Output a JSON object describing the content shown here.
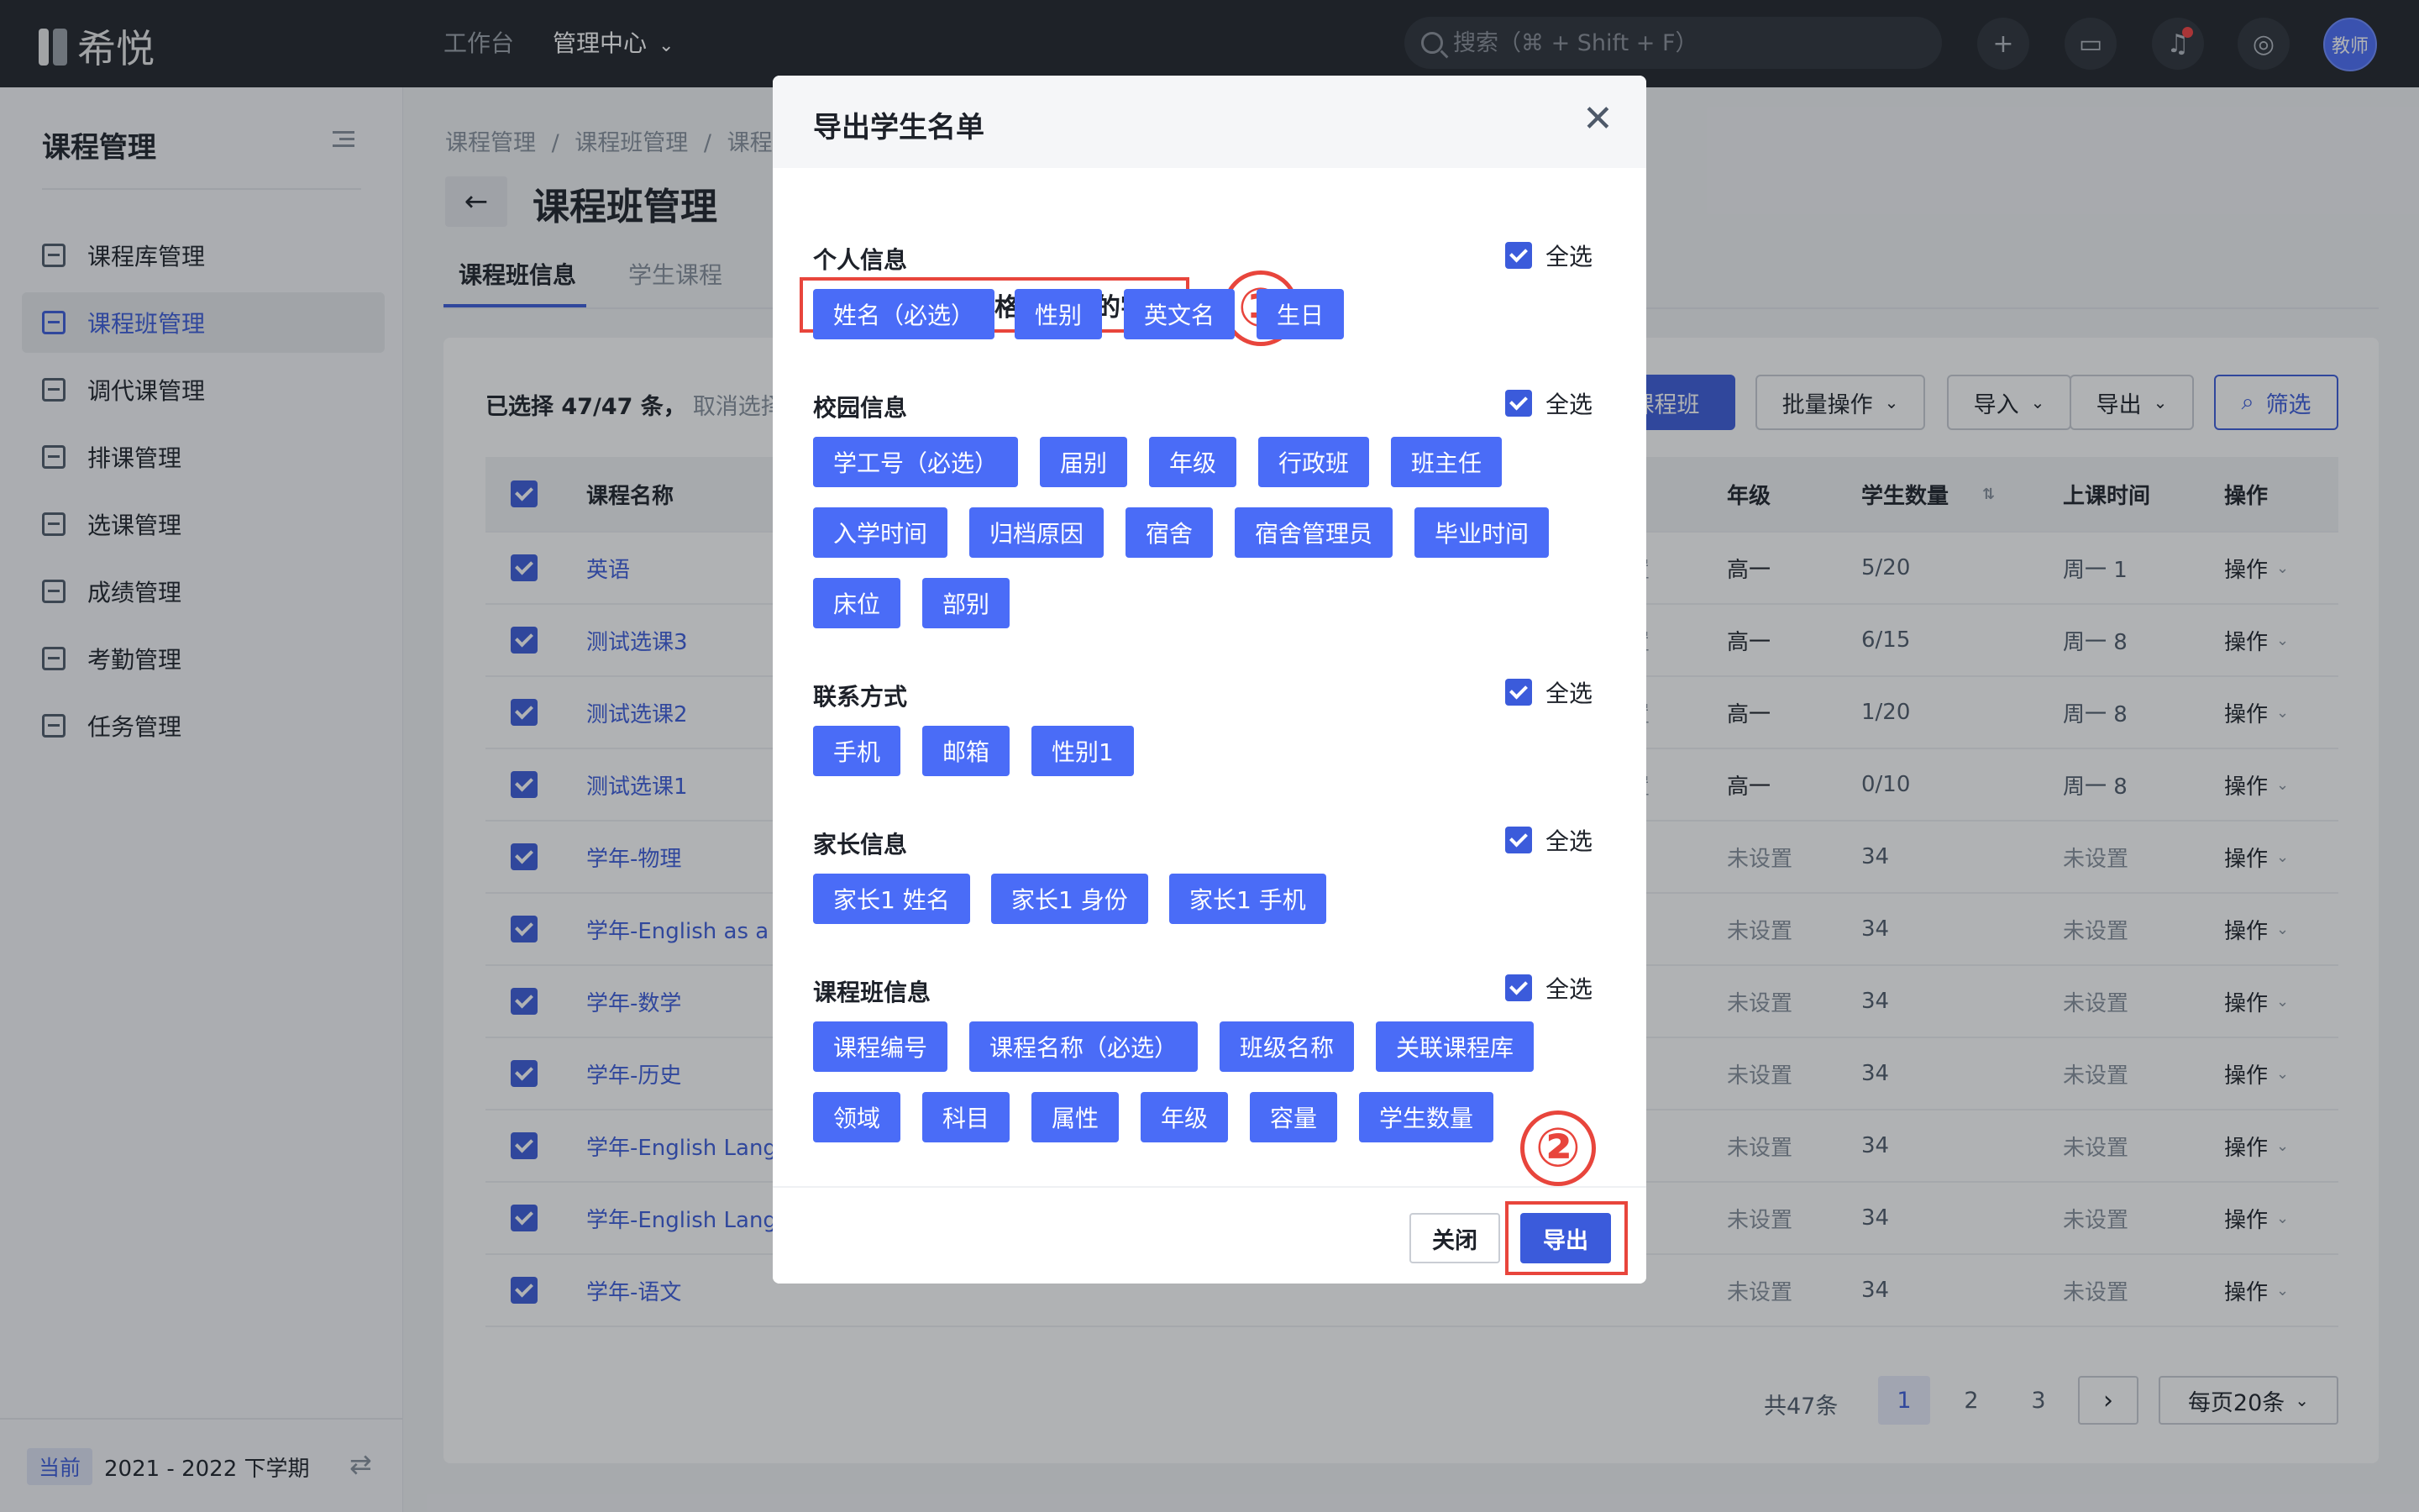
{
  "topbar": {
    "logo_text": "希悦",
    "nav": [
      {
        "label": "工作台",
        "active": false
      },
      {
        "label": "管理中心",
        "active": true,
        "has_dropdown": true
      }
    ],
    "search_placeholder": "搜索（⌘ + Shift + F）",
    "buttons": [
      {
        "name": "add",
        "icon": "plus-icon",
        "glyph": "+"
      },
      {
        "name": "messages",
        "icon": "chat-icon",
        "glyph": "▭"
      },
      {
        "name": "notifications",
        "icon": "bell-icon",
        "glyph": "♫",
        "has_dot": true
      },
      {
        "name": "help",
        "icon": "compass-icon",
        "glyph": "◎"
      }
    ],
    "avatar_label": "教师"
  },
  "sidebar": {
    "title": "课程管理",
    "items": [
      {
        "label": "课程库管理",
        "icon": "library-icon",
        "active": false
      },
      {
        "label": "课程班管理",
        "icon": "class-icon",
        "active": true
      },
      {
        "label": "调代课管理",
        "icon": "substitute-icon",
        "active": false
      },
      {
        "label": "排课管理",
        "icon": "schedule-icon",
        "active": false
      },
      {
        "label": "选课管理",
        "icon": "selection-icon",
        "active": false
      },
      {
        "label": "成绩管理",
        "icon": "grades-icon",
        "active": false
      },
      {
        "label": "考勤管理",
        "icon": "attendance-icon",
        "active": false
      },
      {
        "label": "任务管理",
        "icon": "tasks-icon",
        "active": false
      }
    ],
    "term_badge": "当前",
    "term_text": "2021 - 2022 下学期"
  },
  "main": {
    "breadcrumbs": [
      "课程管理",
      "/",
      "课程班管理",
      "/",
      "课程"
    ],
    "title": "课程班管理",
    "tabs": [
      {
        "label": "课程班信息",
        "active": true
      },
      {
        "label": "学生课程",
        "active": false
      }
    ],
    "selection_prefix": "已选择 47/47 条，",
    "selection_cancel": "取消选择",
    "toolbar": {
      "create_label": "课程班",
      "batch_label": "批量操作",
      "import_label": "导入",
      "export_label": "导出",
      "filter_label": "筛选"
    },
    "table": {
      "headers": {
        "name": "课程名称",
        "grade": "年级",
        "students": "学生数量",
        "time": "上课时间",
        "op": "操作"
      },
      "rows": [
        {
          "name": "英语",
          "mid": "置",
          "grade": "高一",
          "students": "5/20",
          "time": "周一 1",
          "op": "操作"
        },
        {
          "name": "测试选课3",
          "mid": "置",
          "grade": "高一",
          "students": "6/15",
          "time": "周一 8",
          "op": "操作"
        },
        {
          "name": "测试选课2",
          "mid": "置",
          "grade": "高一",
          "students": "1/20",
          "time": "周一 8",
          "op": "操作"
        },
        {
          "name": "测试选课1",
          "mid": "置",
          "grade": "高一",
          "students": "0/10",
          "time": "周一 8",
          "op": "操作"
        },
        {
          "name": "学年-物理",
          "mid": "",
          "grade": "未设置",
          "students": "34",
          "time": "未设置",
          "op": "操作"
        },
        {
          "name": "学年-English as a",
          "mid": "",
          "grade": "未设置",
          "students": "34",
          "time": "未设置",
          "op": "操作"
        },
        {
          "name": "学年-数学",
          "mid": "",
          "grade": "未设置",
          "students": "34",
          "time": "未设置",
          "op": "操作"
        },
        {
          "name": "学年-历史",
          "mid": "",
          "grade": "未设置",
          "students": "34",
          "time": "未设置",
          "op": "操作"
        },
        {
          "name": "学年-English Lang",
          "mid": "",
          "grade": "未设置",
          "students": "34",
          "time": "未设置",
          "op": "操作"
        },
        {
          "name": "学年-English Lang",
          "mid": "",
          "grade": "未设置",
          "students": "34",
          "time": "未设置",
          "op": "操作"
        },
        {
          "name": "学年-语文",
          "mid": "",
          "grade": "未设置",
          "students": "34",
          "time": "未设置",
          "op": "操作"
        }
      ]
    },
    "pager": {
      "total": "共47条",
      "pages": [
        "1",
        "2",
        "3"
      ],
      "current": "1",
      "next": "›",
      "page_size": "每页20条"
    }
  },
  "modal": {
    "title": "导出学生名单",
    "close_glyph": "✕",
    "instruction": "请选择导出的表格中需要的字段",
    "marker_1": "①",
    "marker_2": "②",
    "select_all_label": "全选",
    "sections": [
      {
        "label": "个人信息",
        "fields": [
          "姓名（必选）",
          "性别",
          "英文名",
          "生日"
        ]
      },
      {
        "label": "校园信息",
        "fields": [
          "学工号（必选）",
          "届别",
          "年级",
          "行政班",
          "班主任",
          "入学时间",
          "归档原因",
          "宿舍",
          "宿舍管理员",
          "毕业时间",
          "床位",
          "部别"
        ]
      },
      {
        "label": "联系方式",
        "fields": [
          "手机",
          "邮箱",
          "性别1"
        ]
      },
      {
        "label": "家长信息",
        "fields": [
          "家长1 姓名",
          "家长1 身份",
          "家长1 手机"
        ]
      },
      {
        "label": "课程班信息",
        "fields": [
          "课程编号",
          "课程名称（必选）",
          "班级名称",
          "关联课程库",
          "领域",
          "科目",
          "属性",
          "年级",
          "容量",
          "学生数量"
        ]
      }
    ],
    "cancel_label": "关闭",
    "ok_label": "导出"
  },
  "colors": {
    "accent": "#3b5bdb",
    "chip": "#4a6cf7",
    "annotation_red": "#e8453c",
    "topbar": "#1f2329"
  }
}
